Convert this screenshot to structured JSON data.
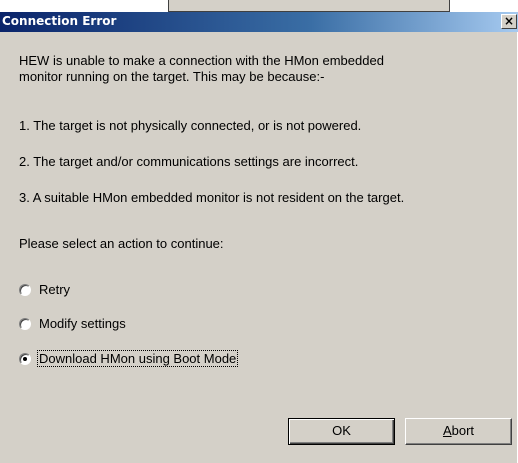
{
  "dialog": {
    "title": "Connection Error",
    "close_symbol": "×",
    "intro_line1": "HEW is unable to make a connection with the HMon embedded",
    "intro_line2": "monitor running on the target. This may be because:-",
    "reasons": [
      "1.  The target is not physically connected, or is not powered.",
      "2.  The target and/or communications settings are incorrect.",
      "3.  A suitable HMon embedded monitor is not resident on the target."
    ],
    "prompt": "Please select an action to continue:",
    "options": [
      {
        "label": "Retry",
        "selected": false
      },
      {
        "label": "Modify settings",
        "selected": false
      },
      {
        "label": "Download HMon using Boot Mode",
        "selected": true
      }
    ],
    "buttons": {
      "ok_label": "OK",
      "abort_mnemonic": "A",
      "abort_rest": "bort"
    }
  },
  "colors": {
    "face": "#d4d0c8",
    "title_start": "#0a246a",
    "title_end": "#a6caf0"
  }
}
